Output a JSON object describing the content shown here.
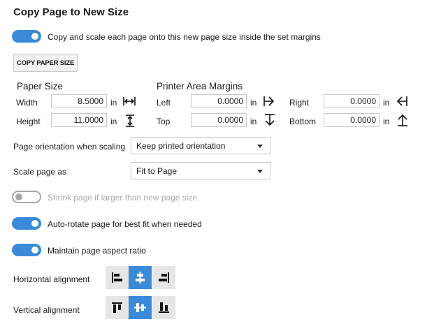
{
  "title": "Copy Page to New Size",
  "copy_scale_toggle": {
    "label": "Copy and scale each page onto this new page size inside the set margins",
    "on": true
  },
  "copy_paper_size_button": "COPY PAPER SIZE",
  "paper_size": {
    "heading": "Paper Size",
    "width_label": "Width",
    "width_value": "8.5000",
    "width_unit": "in",
    "height_label": "Height",
    "height_value": "11.0000",
    "height_unit": "in"
  },
  "margins": {
    "heading": "Printer Area Margins",
    "left_label": "Left",
    "left_value": "0.0000",
    "left_unit": "in",
    "top_label": "Top",
    "top_value": "0.0000",
    "top_unit": "in",
    "right_label": "Right",
    "right_value": "0.0000",
    "right_unit": "in",
    "bottom_label": "Bottom",
    "bottom_value": "0.0000",
    "bottom_unit": "in"
  },
  "orientation": {
    "label": "Page orientation when scaling",
    "value": "Keep printed orientation"
  },
  "scale": {
    "label": "Scale page as",
    "value": "Fit to Page"
  },
  "shrink_toggle": {
    "label": "Shrink page if larger than new page size",
    "on": false,
    "disabled": true
  },
  "autorotate_toggle": {
    "label": "Auto-rotate page for best fit when needed",
    "on": true
  },
  "aspect_toggle": {
    "label": "Maintain page aspect ratio",
    "on": true
  },
  "horizontal_alignment": {
    "label": "Horizontal alignment",
    "options": [
      "align-left-icon",
      "align-center-horizontal-icon",
      "align-right-icon"
    ],
    "selected": 1
  },
  "vertical_alignment": {
    "label": "Vertical alignment",
    "options": [
      "align-top-icon",
      "align-center-vertical-icon",
      "align-bottom-icon"
    ],
    "selected": 1
  },
  "colors": {
    "accent": "#3b8ad9",
    "segment_bg": "#e6e6e6",
    "disabled": "#a8a8a8"
  }
}
